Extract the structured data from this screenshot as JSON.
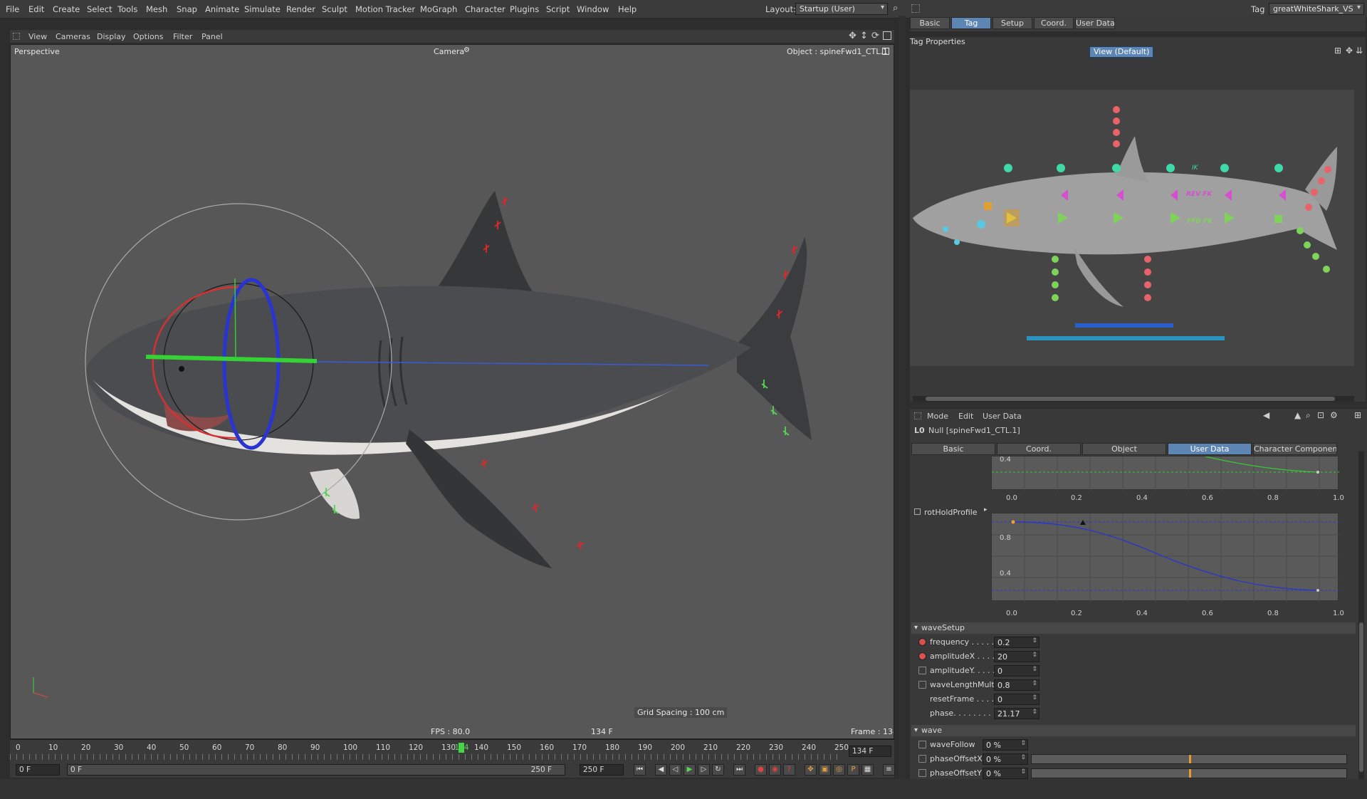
{
  "menubar": {
    "items": [
      "File",
      "Edit",
      "Create",
      "Select",
      "Tools",
      "Mesh",
      "Snap",
      "Animate",
      "Simulate",
      "Render",
      "Sculpt",
      "Motion Tracker",
      "MoGraph",
      "Character",
      "Plugins",
      "Script",
      "Window",
      "Help"
    ],
    "layout_label": "Layout:",
    "layout_value": "Startup (User)",
    "tag_label": "Tag",
    "tag_value": "greatWhiteShark_VS"
  },
  "viewport": {
    "menu": [
      "View",
      "Cameras",
      "Display",
      "Options",
      "Filter",
      "Panel"
    ],
    "view_name": "Perspective",
    "camera_label": "Camera",
    "object_label": "Object : spineFwd1_CTL.1",
    "grid_spacing": "Grid Spacing : 100 cm",
    "fps": "FPS : 80.0",
    "frame_center": "134 F",
    "frame": "Frame : 134"
  },
  "timeline": {
    "ticks": [
      "0",
      "10",
      "20",
      "30",
      "40",
      "50",
      "60",
      "70",
      "80",
      "90",
      "100",
      "110",
      "120",
      "130",
      "134",
      "140",
      "150",
      "160",
      "170",
      "180",
      "190",
      "200",
      "210",
      "220",
      "230",
      "240",
      "250"
    ],
    "current_frame": "134",
    "end_field": "134 F",
    "start_field": "0 F",
    "range_start": "0 F",
    "range_end": "250 F",
    "max_field": "250 F"
  },
  "tag_panel": {
    "tabs": [
      "Basic",
      "Tag",
      "Setup",
      "Coord.",
      "User Data"
    ],
    "active_tab": "Tag",
    "title": "Tag Properties",
    "view_button": "View (Default)",
    "picker_labels": {
      "ik": "IK",
      "rev_fk": "REV FK",
      "ffd_fk": "FFD FK"
    }
  },
  "attributes": {
    "menu": [
      "Mode",
      "Edit",
      "User Data"
    ],
    "object_title": "Null [spineFwd1_CTL.1]",
    "tabs": [
      "Basic",
      "Coord.",
      "Object",
      "User Data",
      "Character Component"
    ],
    "active_tab": "User Data",
    "profile_label": "rotHoldProfile",
    "graph_x_ticks": [
      "0.0",
      "0.2",
      "0.4",
      "0.6",
      "0.8",
      "1.0"
    ],
    "graph1_y_top": "0.4",
    "graph2_y_ticks": [
      "0.8",
      "0.4"
    ],
    "wave_setup_header": "waveSetup",
    "wave_setup": [
      {
        "name": "frequency . . . . . .",
        "value": "0.2",
        "anim": "keyed"
      },
      {
        "name": "amplitudeX . . . . .",
        "value": "20",
        "anim": "keyed"
      },
      {
        "name": "amplitudeY. . . . .",
        "value": "0",
        "anim": "none"
      },
      {
        "name": "waveLengthMult",
        "value": "0.8",
        "anim": "none"
      },
      {
        "name": "resetFrame . . . . .",
        "value": "0",
        "anim": "hidden"
      },
      {
        "name": "phase. . . . . . . . .",
        "value": "21.17",
        "anim": "hidden"
      }
    ],
    "wave_header": "wave",
    "wave": [
      {
        "name": "waveFollow",
        "value": "0 %",
        "slider": 0
      },
      {
        "name": "phaseOffsetX",
        "value": "0 %",
        "slider": 0.5
      },
      {
        "name": "phaseOffsetY",
        "value": "0 %",
        "slider": 0.5
      }
    ]
  },
  "colors": {
    "accent": "#5d86b5",
    "ctrl_cyan": "#3fd9a8",
    "ctrl_red": "#e8626a",
    "ctrl_green": "#7fd35a",
    "ctrl_magenta": "#d54fd0",
    "curve_green": "#37c837",
    "curve_blue": "#2a37c8"
  }
}
